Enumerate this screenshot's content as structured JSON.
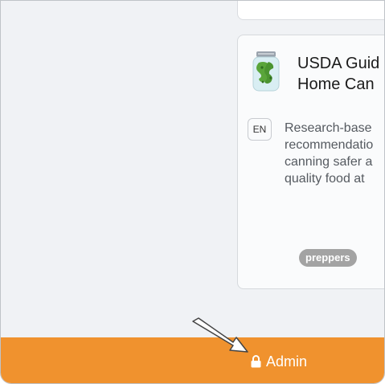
{
  "card": {
    "title_lines": [
      "USDA Guid",
      "Home Can"
    ],
    "language": "EN",
    "description_lines": [
      "Research-base",
      "recommendatio",
      "canning safer a",
      "quality food at"
    ],
    "tag": "preppers",
    "icon": "pickle-jar-icon"
  },
  "footer": {
    "admin_label": "Admin",
    "admin_icon": "lock-icon",
    "color": "#f0922e"
  },
  "cursor_icon": "arrow-pointer-icon"
}
